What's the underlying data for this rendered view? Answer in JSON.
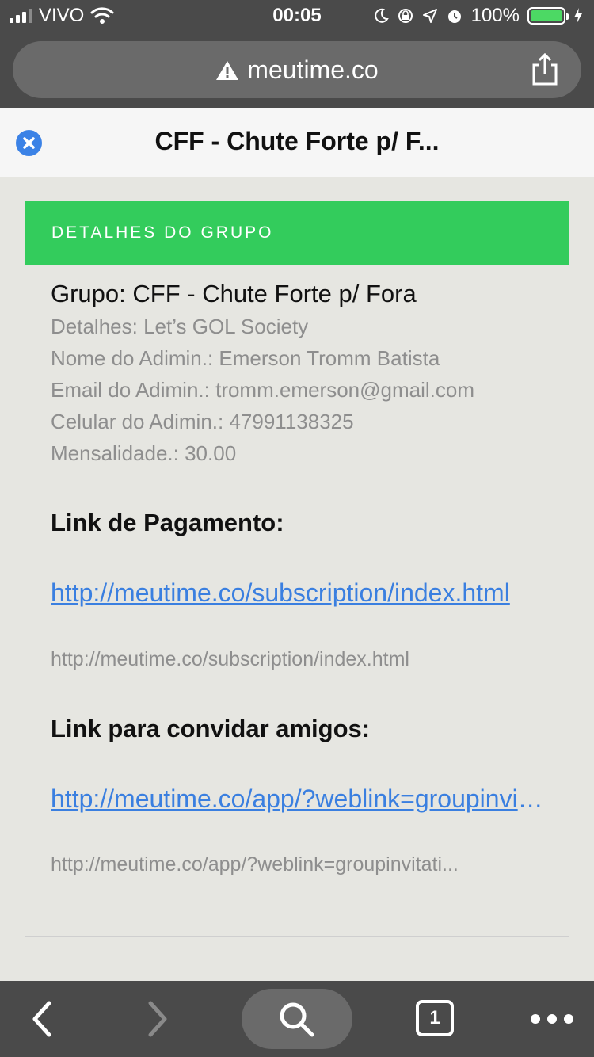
{
  "status_bar": {
    "carrier": "VIVO",
    "time": "00:05",
    "battery": "100%"
  },
  "url_bar": {
    "domain": "meutime.co",
    "icons": [
      "warning-icon",
      "share-icon"
    ]
  },
  "modal": {
    "title": "CFF - Chute Forte p/ F..."
  },
  "section": {
    "header": "DETALHES DO GRUPO"
  },
  "details": {
    "group": "Grupo: CFF - Chute Forte p/ Fora",
    "description": "Detalhes: Let’s GOL Society",
    "admin_name": "Nome do Adimin.: Emerson Tromm Batista",
    "admin_email": "Email do Adimin.: tromm.emerson@gmail.com",
    "admin_phone": "Celular do Adimin.: 47991138325",
    "fee": "Mensalidade.: 30.00"
  },
  "payment": {
    "heading": "Link de Pagamento:",
    "link": "http://meutime.co/subscription/index.html",
    "link_plain": "http://meutime.co/subscription/index.html"
  },
  "invite": {
    "heading": "Link para convidar amigos:",
    "link": "http://meutime.co/app/?weblink=groupinvitation",
    "link_plain": "http://meutime.co/app/?weblink=groupinvitati..."
  },
  "toolbar": {
    "tab_count": "1",
    "icons": [
      "back-icon",
      "forward-icon",
      "search-icon",
      "tabs-icon",
      "more-icon"
    ]
  },
  "colors": {
    "accent_green": "#33cc5c",
    "link_blue": "#3a7fe0",
    "close_blue": "#3b82e6"
  }
}
